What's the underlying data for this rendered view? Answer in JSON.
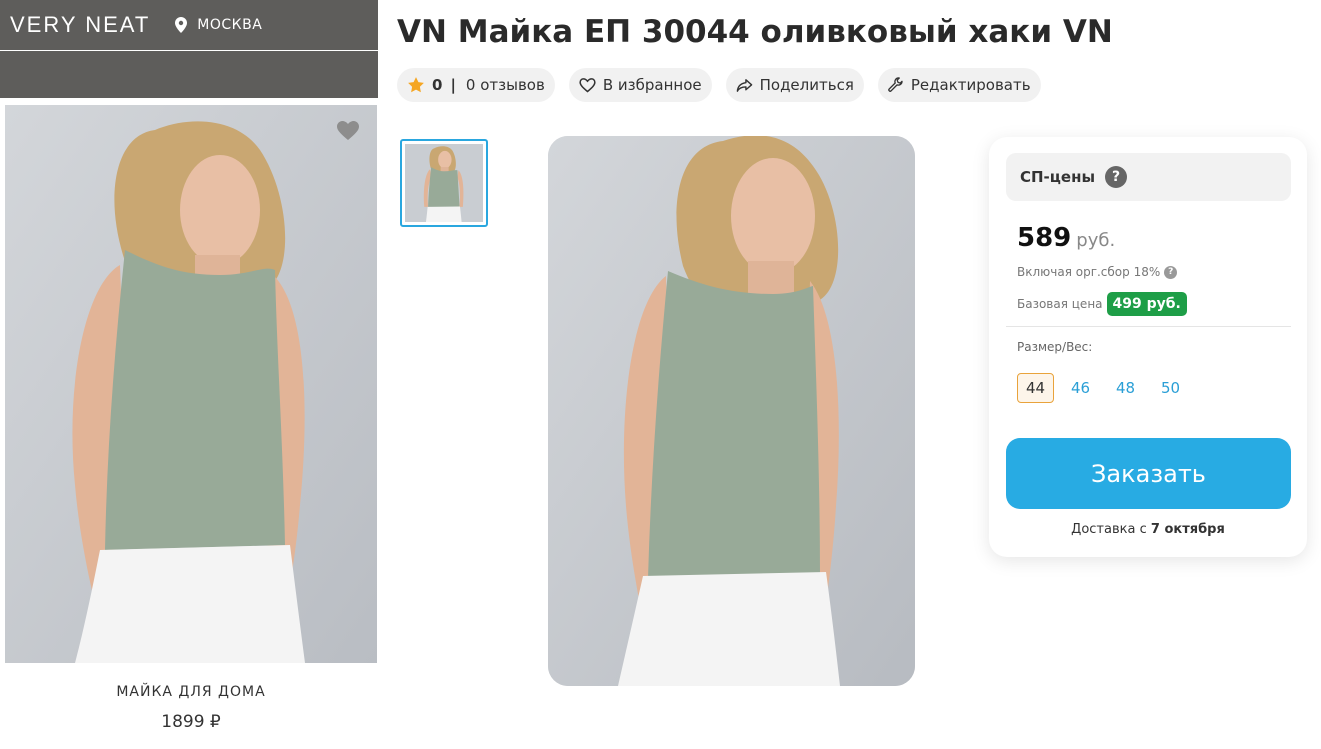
{
  "brand": {
    "logo": "VERY  NEAT",
    "city": "МОСКВА"
  },
  "left_card": {
    "name": "МАЙКА ДЛЯ ДОМА",
    "price": "1899 ₽"
  },
  "product": {
    "title": "VN Майка ЕП 30044 оливковый хаки VN",
    "rating": "0",
    "rating_sep": "|",
    "reviews": "0 отзывов",
    "favorite_label": "В избранное",
    "share_label": "Поделиться",
    "edit_label": "Редактировать"
  },
  "pricing": {
    "sp_label": "СП-цены",
    "help_glyph": "?",
    "price": "589",
    "currency": "руб.",
    "fee_note": "Включая орг.сбор 18%",
    "base_label": "Базовая цена",
    "base_price": "499 руб.",
    "size_label": "Размер/Вес:",
    "sizes": [
      "44",
      "46",
      "48",
      "50"
    ],
    "selected_size": "44",
    "order_label": "Заказать",
    "delivery_prefix": "Доставка с",
    "delivery_date": "7 октября"
  },
  "colors": {
    "topbar": "#5e5d5b",
    "accent_blue": "#28abe3",
    "base_price_green": "#1e9e47",
    "rating_star": "#f5a623",
    "selected_size_border": "#e9a33b"
  }
}
